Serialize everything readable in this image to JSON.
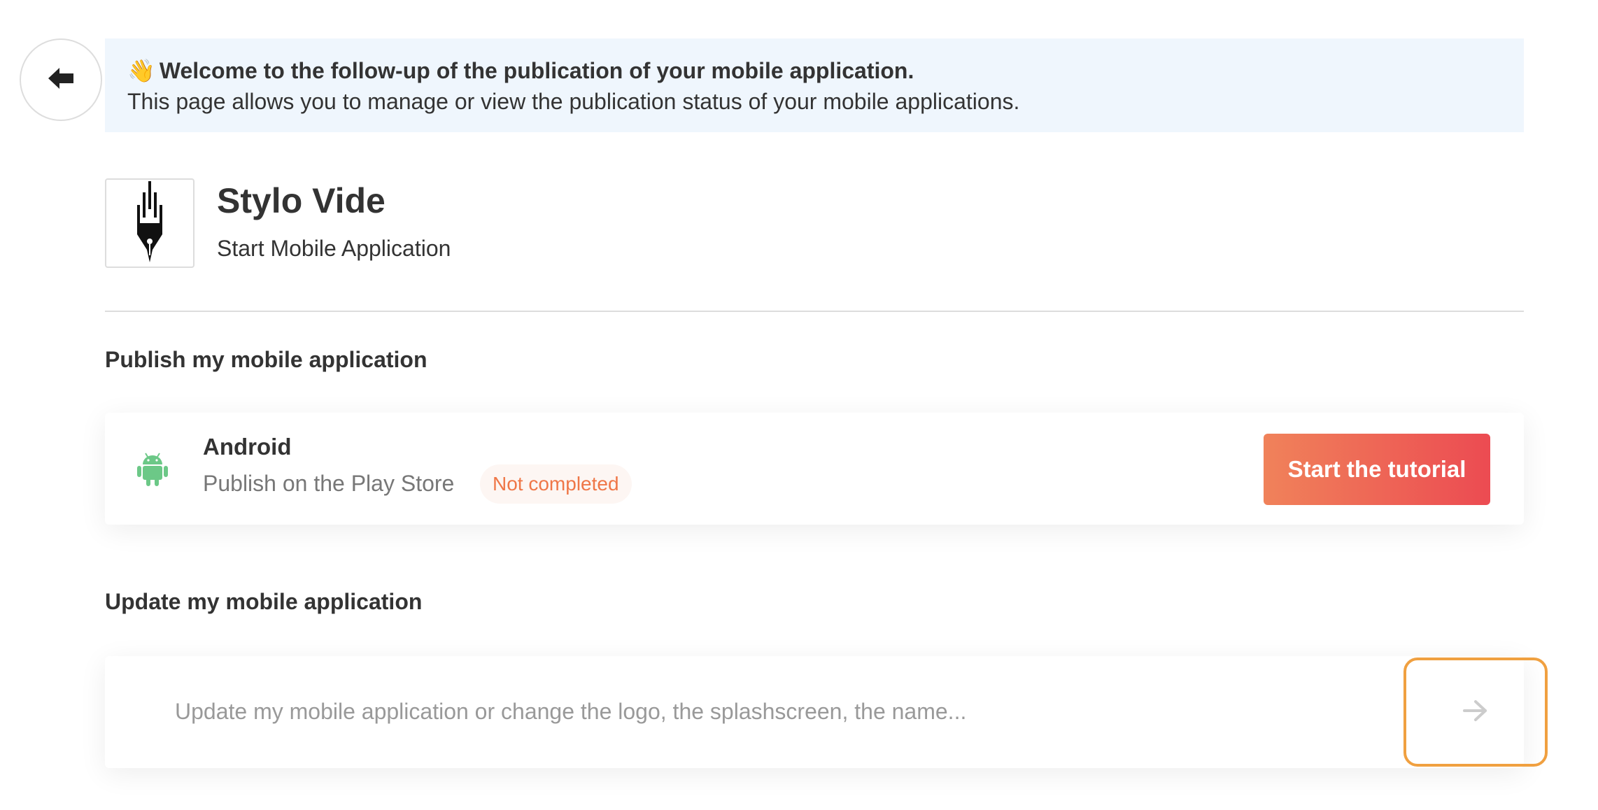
{
  "nav": {
    "back_icon": "arrow-left-icon"
  },
  "banner": {
    "emoji": "👋",
    "title": "Welcome to the follow-up of the publication of your mobile application.",
    "description": "This page allows you to manage or view the publication status of your mobile applications.",
    "background": "#eff6fd"
  },
  "app": {
    "name": "Stylo Vide",
    "type": "Start Mobile Application",
    "logo_icon": "fountain-pen-icon"
  },
  "publish": {
    "section_title": "Publish my mobile application",
    "platform_name": "Android",
    "platform_icon": "android-icon",
    "platform_desc": "Publish on the Play Store",
    "status": "Not completed",
    "button_label": "Start the tutorial",
    "accent": "#ec4b52"
  },
  "update": {
    "section_title": "Update my mobile application",
    "description": "Update my mobile application or change the logo, the splashscreen, the name...",
    "arrow_icon": "arrow-right-icon",
    "focus_color": "#f0a040"
  }
}
